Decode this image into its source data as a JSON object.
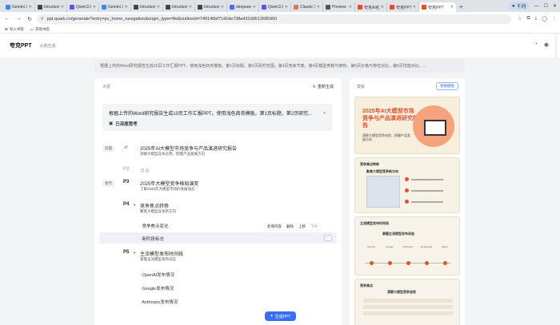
{
  "browser": {
    "tabs": [
      {
        "title": "Gemini 3",
        "color": "#4285f4"
      },
      {
        "title": "Introduci",
        "color": "#444444"
      },
      {
        "title": "Qwen3.5",
        "color": "#6b4de6"
      },
      {
        "title": "Gemini 3",
        "color": "#4285f4"
      },
      {
        "title": "Introduci",
        "color": "#444444"
      },
      {
        "title": "Introduci",
        "color": "#444444"
      },
      {
        "title": "Introduci",
        "color": "#444444"
      },
      {
        "title": "deepseek",
        "color": "#4d6bfe"
      },
      {
        "title": "Qwen3.5",
        "color": "#6b4de6"
      },
      {
        "title": "Claude 3",
        "color": "#d97757"
      },
      {
        "title": "Preview",
        "color": "#555555"
      },
      {
        "title": "夸克AI初",
        "color": "#e0502a"
      },
      {
        "title": "夸克PPT",
        "color": "#e0502a"
      },
      {
        "title": "夸克PPT",
        "color": "#e0502a"
      }
    ],
    "active_tab_index": 13,
    "new_tab": "+",
    "profile": "千问",
    "url": "ppt.quark.cn/generate?entry=pc_home_navigation&origin_type=file&outlineId=749146bf7142de738a432d9513685960",
    "bookmarks": [
      {
        "label": "导入书签"
      },
      {
        "label": "其他书签"
      }
    ]
  },
  "app": {
    "logo": "夸克PPT",
    "breadcrumb": "大纲生成",
    "prompt": "根据上传的Word研究报告生成10页工作汇报PPT。使用浅色商务模板。第1页标题，第2页研究范围，第3页竞争节奏，第4页模型参数与架构，第5页价格与特性对比，第6页性能对比，...",
    "outline": {
      "label": "大纲",
      "regenerate": "重新生成",
      "summary": "根据上传的Word研究报告生成10页工作汇报PPT。使用浅色商务模板。第1页标题，第2页研究...",
      "thinking": "已深度思考",
      "rows": [
        {
          "tag": "封面",
          "num": "",
          "title": "2025年AI大模型市场竞争与产品演进研究报告",
          "sub": "洞察大模型竞争态势，把握产品发展方向"
        },
        {
          "tag": "",
          "num": "P2",
          "title": "目录",
          "sub": ""
        },
        {
          "tag": "章节",
          "num": "P3",
          "title": "2025年大模型竞争格局演变",
          "sub": "了解2025年大模型市场的发展动态"
        },
        {
          "tag": "",
          "num": "P4",
          "title": "竞争焦点转移",
          "sub": "聚焦大模型竞争新方向"
        },
        {
          "tag": "",
          "num": "P5",
          "title": "主流模型发布时间线",
          "sub": "掌握主流模型发布动态"
        }
      ],
      "bullets_p4": [
        "竞争焦点变化",
        "新阶段标志"
      ],
      "bullets_p5": [
        "OpenAI发布情况",
        "Google发布情况",
        "Anthropic发布情况"
      ],
      "row_actions": [
        {
          "label": "新增内容",
          "disabled": false
        },
        {
          "label": "删除",
          "disabled": false
        },
        {
          "label": "上移",
          "disabled": false
        },
        {
          "label": "下移",
          "disabled": true
        }
      ],
      "more": "···"
    },
    "template": {
      "label": "模板",
      "change_button": "更换模板",
      "slide1_title": "2025年AI大模型市场竞争与产品演进研究报告",
      "slide1_sub": "洞察大模型竞争态势，把握产品发展方向",
      "slide2_head": "竞争焦点转移",
      "slide2_title": "聚焦大模型竞争新方向",
      "slide3_head": "主流模型发布时间线",
      "slide3_title": "掌握主流模型发布动态",
      "slide3_labels": [
        "OpenAI",
        "Google",
        "Anthropic",
        "DeepSeek",
        "Qwen"
      ],
      "slide4_head": "竞争焦点",
      "slide4_title": "洞察大模型竞争态势"
    },
    "generate_button": "生成PPT"
  },
  "colors": {
    "accent": "#3a6ef0",
    "brand": "#e0502a"
  }
}
